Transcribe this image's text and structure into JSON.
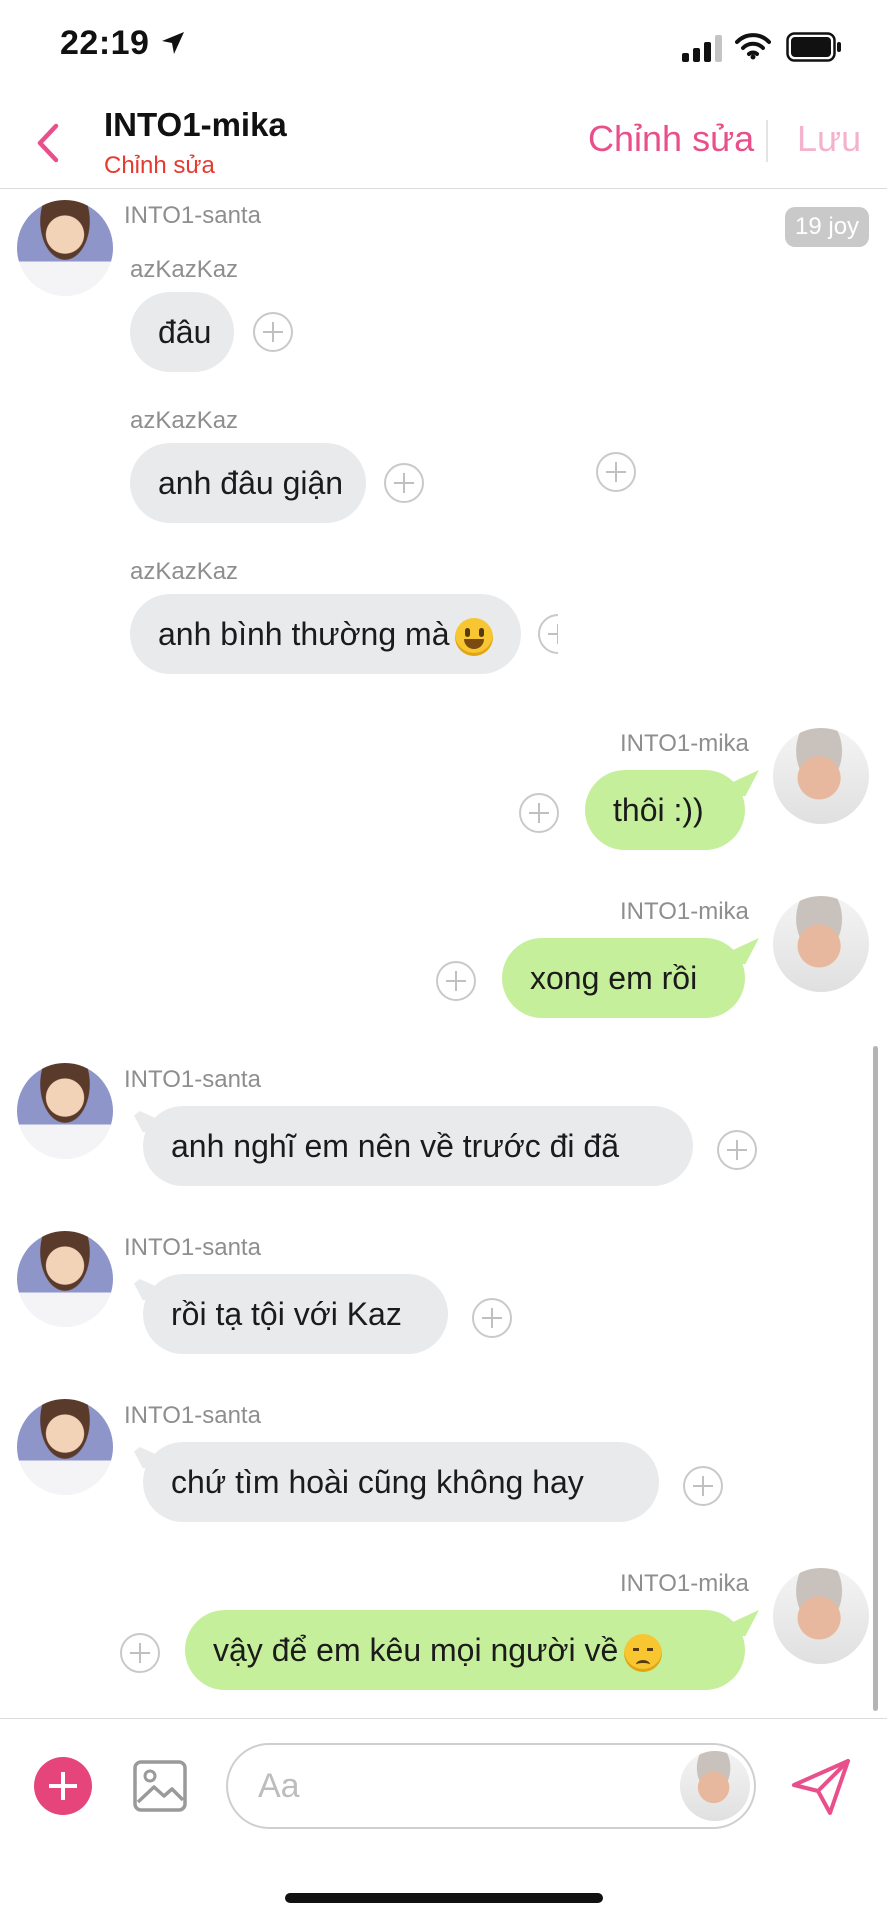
{
  "status_bar": {
    "time": "22:19"
  },
  "header": {
    "title": "INTO1-mika",
    "subtitle": "Chỉnh sửa",
    "edit_label": "Chỉnh sửa",
    "save_label": "Lưu"
  },
  "messages": [
    {
      "sender": "INTO1-santa",
      "text": "",
      "time_badge": "19 joy"
    },
    {
      "sender": "azKazKaz",
      "text": "đâu"
    },
    {
      "sender": "azKazKaz",
      "text": "anh đâu giận"
    },
    {
      "sender": "azKazKaz",
      "text": "anh bình thường mà"
    },
    {
      "sender": "INTO1-mika",
      "text": "thôi :))"
    },
    {
      "sender": "INTO1-mika",
      "text": "xong em rồi"
    },
    {
      "sender": "INTO1-santa",
      "text": "anh nghĩ em nên về trước đi đã"
    },
    {
      "sender": "INTO1-santa",
      "text": "rồi tạ tội với Kaz"
    },
    {
      "sender": "INTO1-santa",
      "text": "chứ tìm hoài cũng không hay"
    },
    {
      "sender": "INTO1-mika",
      "text": "vậy để em kêu mọi người về"
    }
  ],
  "input": {
    "placeholder": "Aa"
  },
  "icons": {
    "back": "chevron-left-icon",
    "add": "plus-circle-icon",
    "image": "image-icon",
    "send": "paper-plane-icon",
    "reaction": "add-reaction-icon"
  },
  "colors": {
    "accent": "#e94f8a",
    "subtitle": "#e43a2f",
    "incoming_bubble": "#e8eaec",
    "outgoing_bubble": "#c5ef9b",
    "add_button": "#e6457c"
  }
}
